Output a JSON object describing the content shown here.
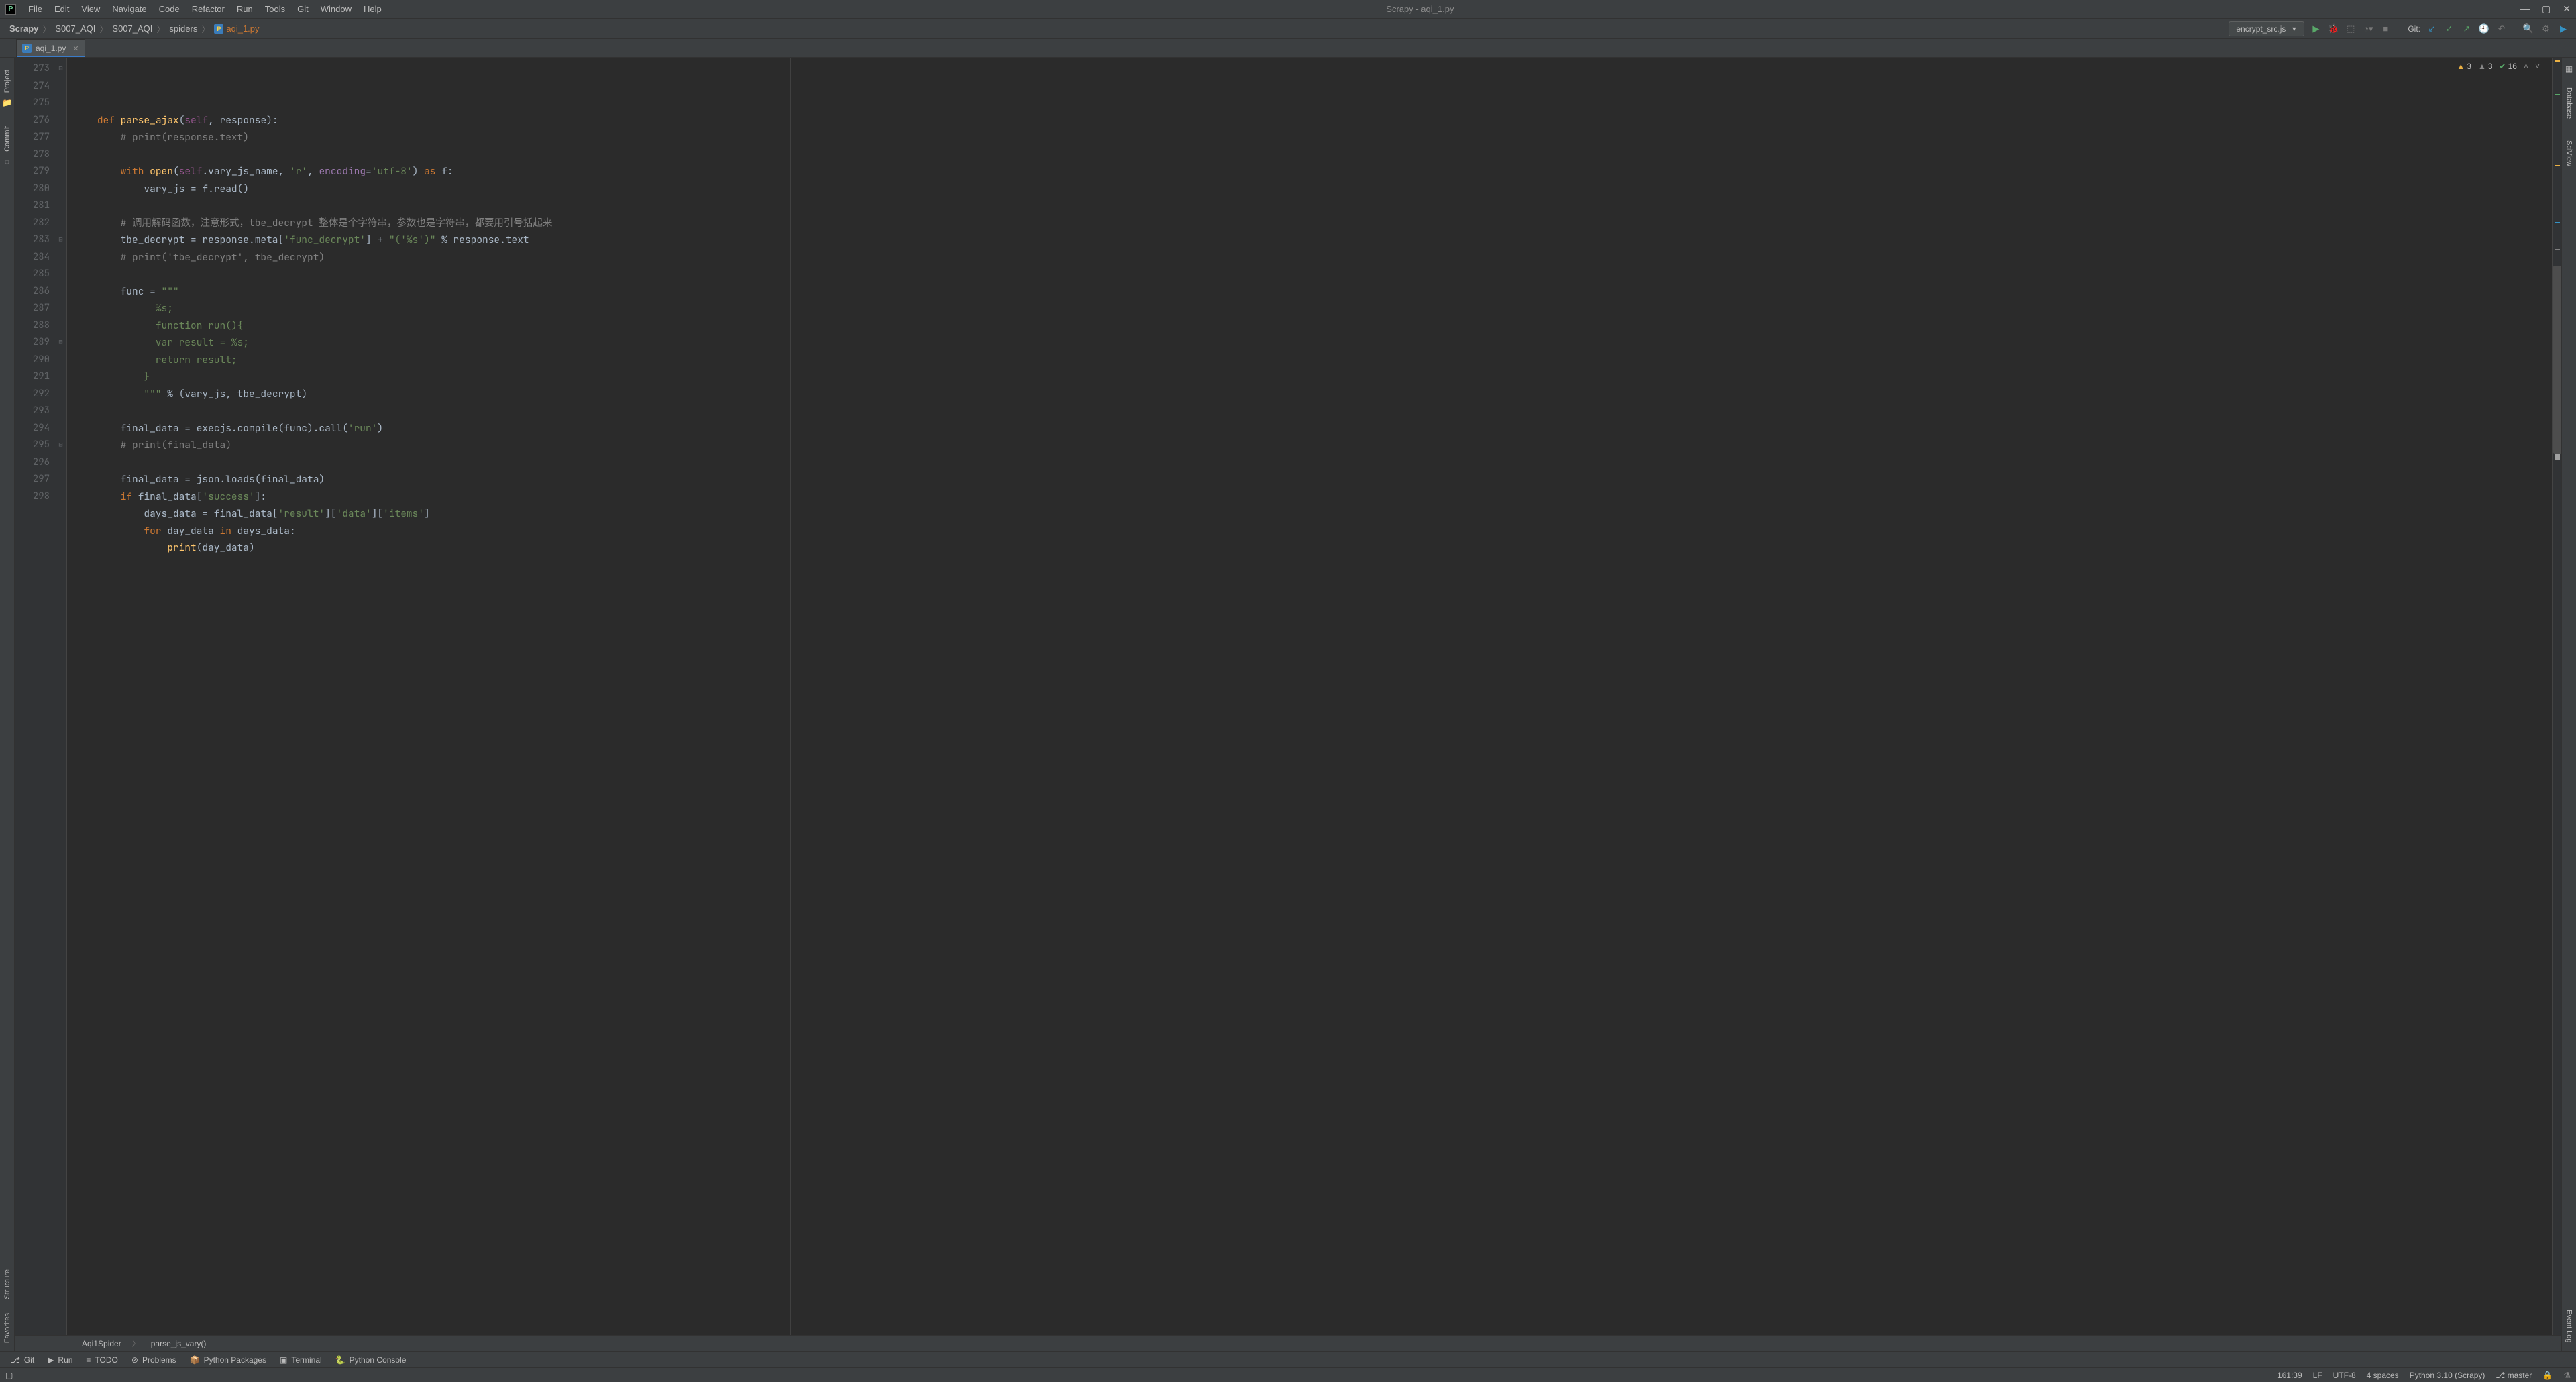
{
  "window": {
    "title": "Scrapy - aqi_1.py"
  },
  "menu": [
    "File",
    "Edit",
    "View",
    "Navigate",
    "Code",
    "Refactor",
    "Run",
    "Tools",
    "Git",
    "Window",
    "Help"
  ],
  "breadcrumbs": [
    "Scrapy",
    "S007_AQI",
    "S007_AQI",
    "spiders",
    "aqi_1.py"
  ],
  "run_config": "encrypt_src.js",
  "git_label": "Git:",
  "tabs": [
    {
      "name": "aqi_1.py",
      "active": true
    }
  ],
  "left_tools": [
    "Project",
    "Commit"
  ],
  "right_tools": [
    "Database",
    "SciView"
  ],
  "inspections": {
    "errors": "3",
    "warnings": "3",
    "weak": "16"
  },
  "code_lines": {
    "start": 273,
    "lines": [
      {
        "n": 273,
        "html": "<span class='kw'>def</span> <span class='fn'>parse_ajax</span>(<span class='self'>self</span>, response):"
      },
      {
        "n": 274,
        "html": "    <span class='cmt'># print(response.text)</span>"
      },
      {
        "n": 275,
        "html": ""
      },
      {
        "n": 276,
        "html": "    <span class='kw'>with</span> <span class='fn'>open</span>(<span class='self'>self</span>.vary_js_name, <span class='str'>'r'</span>, <span class='field'>encoding</span>=<span class='str'>'utf-8'</span>) <span class='kw'>as</span> f:"
      },
      {
        "n": 277,
        "html": "        vary_js = f.read()"
      },
      {
        "n": 278,
        "html": ""
      },
      {
        "n": 279,
        "html": "    <span class='cmt'># 调用解码函数，注意形式，tbe_decrypt 整体是个字符串，参数也是字符串，都要用引号括起来</span>"
      },
      {
        "n": 280,
        "html": "    tbe_decrypt = response.meta[<span class='str'>'func_decrypt'</span>] + <span class='str'>\"('%s')\"</span> % response.text"
      },
      {
        "n": 281,
        "html": "    <span class='cmt'># print('tbe_decrypt', tbe_decrypt)</span>"
      },
      {
        "n": 282,
        "html": ""
      },
      {
        "n": 283,
        "html": "    func = <span class='docstr'>\"\"\"</span>"
      },
      {
        "n": 284,
        "html": "<span class='docstr'>          %s;</span>"
      },
      {
        "n": 285,
        "html": "<span class='docstr'>          function run(){</span>"
      },
      {
        "n": 286,
        "html": "<span class='docstr'>          var result = %s;</span>"
      },
      {
        "n": 287,
        "html": "<span class='docstr'>          return result;</span>"
      },
      {
        "n": 288,
        "html": "<span class='docstr'>        }</span>"
      },
      {
        "n": 289,
        "html": "<span class='docstr'>        \"\"\"</span> % (vary_js, tbe_decrypt)"
      },
      {
        "n": 290,
        "html": ""
      },
      {
        "n": 291,
        "html": "    final_data = execjs.compile(func).call(<span class='str'>'run'</span>)"
      },
      {
        "n": 292,
        "html": "    <span class='cmt'># print(final_data)</span>"
      },
      {
        "n": 293,
        "html": ""
      },
      {
        "n": 294,
        "html": "    final_data = json.loads(final_data)"
      },
      {
        "n": 295,
        "html": "    <span class='kw'>if</span> final_data[<span class='str'>'success'</span>]:"
      },
      {
        "n": 296,
        "html": "        days_data = final_data[<span class='str'>'result'</span>][<span class='str'>'data'</span>][<span class='str'>'items'</span>]"
      },
      {
        "n": 297,
        "html": "        <span class='kw'>for</span> day_data <span class='kw'>in</span> days_data:"
      },
      {
        "n": 298,
        "html": "            <span class='fn'>print</span>(day_data)"
      }
    ]
  },
  "code_breadcrumbs": [
    "Aqi1Spider",
    "parse_js_vary()"
  ],
  "bottom_tools": [
    {
      "icon": "⎇",
      "label": "Git"
    },
    {
      "icon": "▶",
      "label": "Run"
    },
    {
      "icon": "≡",
      "label": "TODO"
    },
    {
      "icon": "⊘",
      "label": "Problems"
    },
    {
      "icon": "📦",
      "label": "Python Packages"
    },
    {
      "icon": "▣",
      "label": "Terminal"
    },
    {
      "icon": "🐍",
      "label": "Python Console"
    }
  ],
  "status": {
    "cursor": "161:39",
    "line_sep": "LF",
    "encoding": "UTF-8",
    "indent": "4 spaces",
    "interpreter": "Python 3.10 (Scrapy)",
    "branch_icon": "⎇",
    "branch": "master",
    "right_label": "Event Log",
    "favorites": "Favorites",
    "structure": "Structure"
  }
}
